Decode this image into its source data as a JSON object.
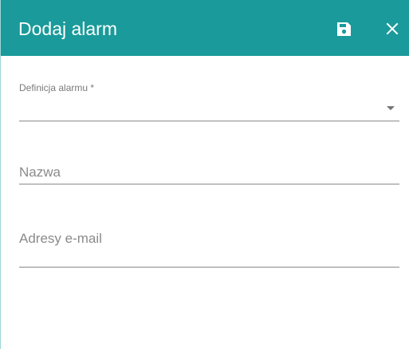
{
  "dialog": {
    "title": "Dodaj alarm",
    "header_color": "#1a9a9a",
    "save_icon": "save-icon",
    "close_icon": "close-icon"
  },
  "form": {
    "alarm_definition": {
      "label": "Definicja alarmu *",
      "value": ""
    },
    "name": {
      "placeholder": "Nazwa",
      "value": ""
    },
    "emails": {
      "placeholder": "Adresy e-mail",
      "value": ""
    }
  }
}
